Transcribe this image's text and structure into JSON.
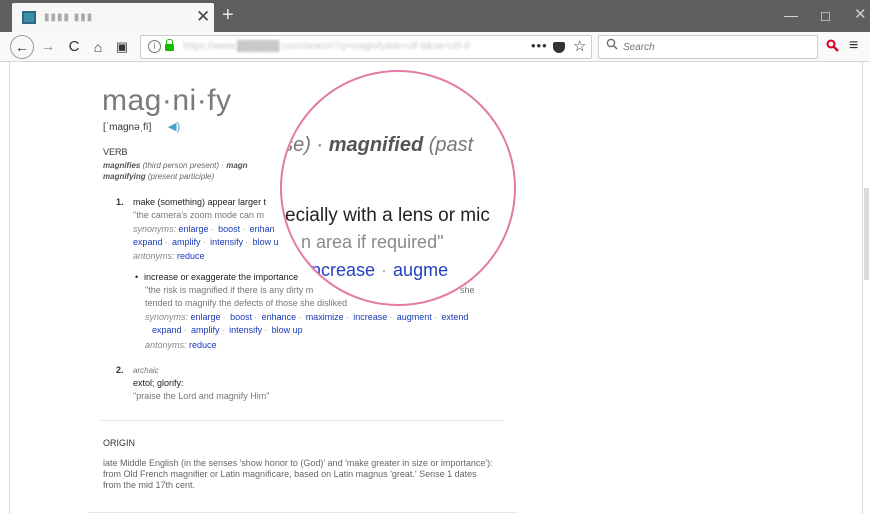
{
  "browser": {
    "tab_title": "▮▮▮▮ ▮▮▮",
    "tab_close": "✕",
    "new_tab": "+",
    "window_minimize": "—",
    "window_maximize": "☐",
    "window_close": "✕",
    "back_icon": "←",
    "forward_icon": "→",
    "reload_icon": "C",
    "home_icon": "⌂",
    "reader_icon": "▣",
    "info_icon": "i",
    "url": "https://www.██████.com/search?q=magnify&ie=utf-8&oe=utf-8",
    "page_actions": "•••",
    "star_icon": "☆",
    "search_icon": "🔍",
    "search_placeholder": "Search",
    "search_addon_icon": "🔍",
    "menu_icon": "≡",
    "accent_color": "#12bc00"
  },
  "entry": {
    "headword": "mag·ni·fy",
    "pronunciation": "[ˈmagnəˌfī]",
    "audio_icon": "◀)",
    "part_of_speech": "VERB",
    "forms_line1_a": "magnifies",
    "forms_line1_b": "(third person present)",
    "forms_line1_c": "·",
    "forms_line1_d": "magn",
    "forms_line2_a": "magnifying",
    "forms_line2_b": "(present participle)",
    "sense1": {
      "number": "1.",
      "definition": "make (something) appear larger t",
      "example": "\"the camera's zoom mode can m",
      "synonyms_label": "synonyms:",
      "synonyms": [
        "enlarge",
        "boost",
        "enhan"
      ],
      "synonyms_row2": [
        "expand",
        "amplify",
        "intensify",
        "blow u"
      ],
      "antonyms_label": "antonyms:",
      "antonyms": [
        "reduce"
      ]
    },
    "subsense": {
      "bullet": "•",
      "definition": "increase or exaggerate the importance",
      "example_line1": "\"the risk is magnified if there is any dirty m",
      "example_line1_tail": "she",
      "example_line2": "tended to magnify the defects of those she disliked",
      "synonyms_label": "synonyms:",
      "synonyms": [
        "enlarge",
        "boost",
        "enhance",
        "maximize",
        "increase",
        "augment",
        "extend"
      ],
      "synonyms_row2": [
        "expand",
        "amplify",
        "intensify",
        "blow up"
      ],
      "antonyms_label": "antonyms:",
      "antonyms": [
        "reduce"
      ]
    },
    "sense2": {
      "number": "2.",
      "label": "archaic",
      "definition": "extol; glorify:",
      "example": "\"praise the Lord and magnify Him\""
    },
    "origin_heading": "ORIGIN",
    "origin_text": "late Middle English (in the senses 'show honor to (God)' and 'make greater in size or importance'): from Old French magnifier or Latin magnificare, based on Latin magnus 'great.' Sense 1 dates from the mid 17th cent."
  },
  "magnifier": {
    "line1_a": "nse)",
    "line1_b": "·",
    "line1_c": "magnified",
    "line1_d": "(past",
    "line2": "ecially with a lens or mic",
    "line3": "n area if required\"",
    "line4_a": "increase",
    "line4_b": "·",
    "line4_c": "augme",
    "ring_color": "#e27aa7"
  }
}
